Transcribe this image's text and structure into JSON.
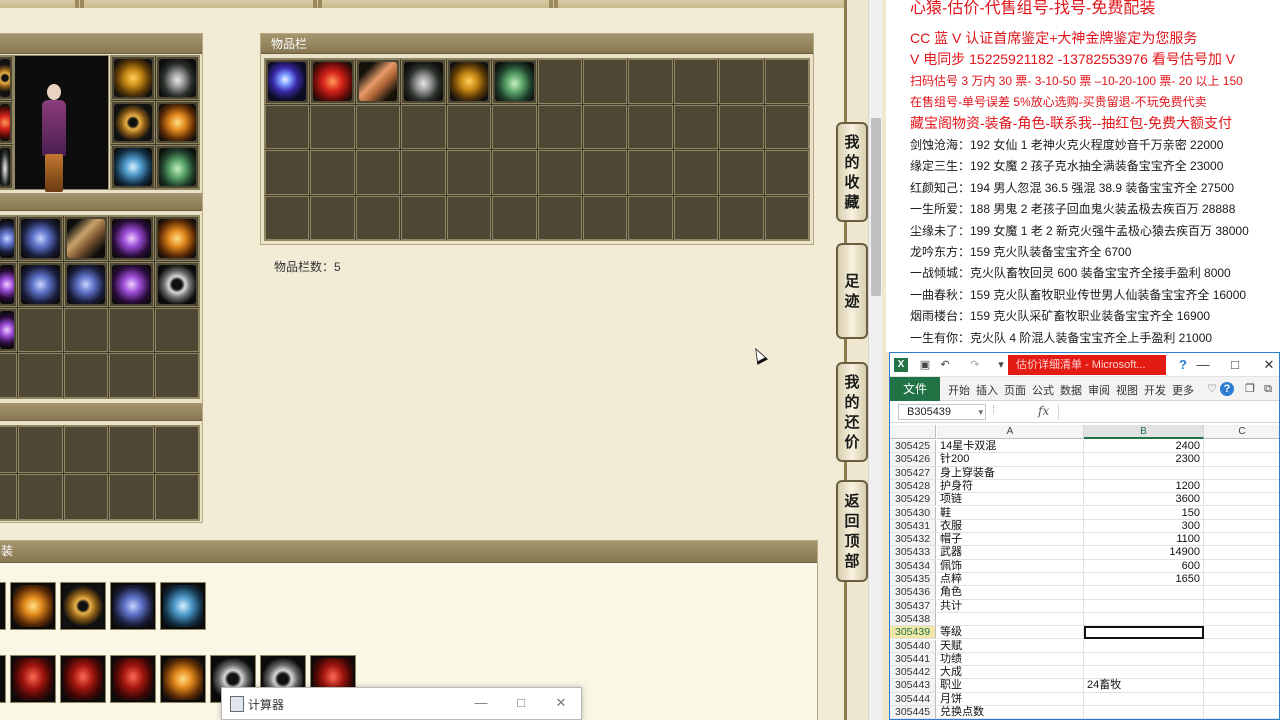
{
  "game": {
    "inventory_title": "物品栏",
    "inventory_count_label": "物品栏数：5",
    "inventory_items": [
      {
        "icon": "lightning-icon",
        "cls": "item-lightning"
      },
      {
        "icon": "red-orb-icon",
        "cls": "item-orb-red"
      },
      {
        "icon": "pyramid-icon",
        "cls": "item-pyramid"
      },
      {
        "icon": "bracelet-icon",
        "cls": "item-bracelet"
      },
      {
        "icon": "golden-mask-icon",
        "cls": "item-mask-gold"
      },
      {
        "icon": "green-shoes-icon",
        "cls": "item-shoes-green"
      }
    ],
    "side_tabs": [
      {
        "name": "my-favorites",
        "chars": [
          "我",
          "的",
          "收",
          "藏"
        ]
      },
      {
        "name": "footprints",
        "chars": [
          "足",
          "迹"
        ]
      },
      {
        "name": "my-offers",
        "chars": [
          "我",
          "的",
          "还",
          "价"
        ]
      },
      {
        "name": "back-to-top",
        "chars": [
          "返",
          "回",
          "顶",
          "部"
        ]
      }
    ],
    "equipment_header_fragment": "装",
    "calculator_title": "计算器",
    "calculator_controls": {
      "minimize": "—",
      "maximize": "□",
      "close": "✕"
    }
  },
  "ad": {
    "line0": "心猿-估价-代售组号-找号-免费配装",
    "line1": "CC 蓝 V 认证首席鉴定+大神金牌鉴定为您服务",
    "line2": "V 电同步 15225921182 -13782553976 看号估号加 V",
    "line3": "扫码估号 3 万内 30 票- 3-10-50 票 –10-20-100 票- 20 以上 150",
    "line4": "在售组号-单号误差 5%放心选购-买贵留退-不玩免费代卖",
    "line5": "藏宝阁物资-装备-角色-联系我--抽红包-免费大额支付",
    "entries": [
      "剑蚀沧海：192 女仙 1 老神火克火程度妙音千万亲密 22000",
      "缘定三生：192 女魔 2 孩子克水抽全满装备宝宝齐全 23000",
      "红颜知己：194 男人忽混 36.5 强混 38.9 装备宝宝齐全 27500",
      "一生所爱：188 男鬼 2 老孩子回血鬼火装孟极去疾百万 28888",
      "尘缘未了：199 女魔 1 老 2 新克火强牛孟极心猿去疾百万 38000",
      "龙吟东方：159 克火队装备宝宝齐全 6700",
      "一战倾城：克火队畜牧回灵 600 装备宝宝齐全接手盈利 8000",
      "一曲春秋：159 克火队畜牧职业传世男人仙装备宝宝齐全 16000",
      "烟雨楼台：159 克火队采矿畜牧职业装备宝宝齐全 16900",
      "一生有你：克火队 4 阶混人装备宝宝齐全上手盈利 21000"
    ]
  },
  "excel": {
    "app_letter": "X",
    "doc_title": "估价详细清单 - Microsoft...",
    "window_controls": {
      "help": "?",
      "restore": "❐",
      "minimize": "—",
      "maximize": "□",
      "close": "✕"
    },
    "ribbon_tabs": [
      "文件",
      "开始",
      "插入",
      "页面",
      "公式",
      "数据",
      "审阅",
      "视图",
      "开发",
      "更多"
    ],
    "name_box": "B305439",
    "fx_label": "fx",
    "columns": [
      "A",
      "B",
      "C"
    ],
    "rows": [
      {
        "n": "305425",
        "a": "14星卡双混",
        "b": "2400"
      },
      {
        "n": "305426",
        "a": "针200",
        "b": "2300"
      },
      {
        "n": "305427",
        "a": "身上穿装备",
        "b": ""
      },
      {
        "n": "305428",
        "a": "护身符",
        "b": "1200"
      },
      {
        "n": "305429",
        "a": "项链",
        "b": "3600"
      },
      {
        "n": "305430",
        "a": "鞋",
        "b": "150"
      },
      {
        "n": "305431",
        "a": "衣服",
        "b": "300"
      },
      {
        "n": "305432",
        "a": "帽子",
        "b": "1100"
      },
      {
        "n": "305433",
        "a": "武器",
        "b": "14900"
      },
      {
        "n": "305434",
        "a": "佩饰",
        "b": "600"
      },
      {
        "n": "305435",
        "a": "点粹",
        "b": "1650"
      },
      {
        "n": "305436",
        "a": "角色",
        "b": ""
      },
      {
        "n": "305437",
        "a": "共计",
        "b": ""
      },
      {
        "n": "305438",
        "a": "",
        "b": ""
      },
      {
        "n": "305439",
        "a": "等级",
        "b": ""
      },
      {
        "n": "305440",
        "a": "天赋",
        "b": ""
      },
      {
        "n": "305441",
        "a": "功绩",
        "b": ""
      },
      {
        "n": "305442",
        "a": "大成",
        "b": ""
      },
      {
        "n": "305443",
        "a": "职业",
        "b": "24畜牧"
      },
      {
        "n": "305444",
        "a": "月饼",
        "b": ""
      },
      {
        "n": "305445",
        "a": "兑换点数",
        "b": ""
      }
    ]
  }
}
